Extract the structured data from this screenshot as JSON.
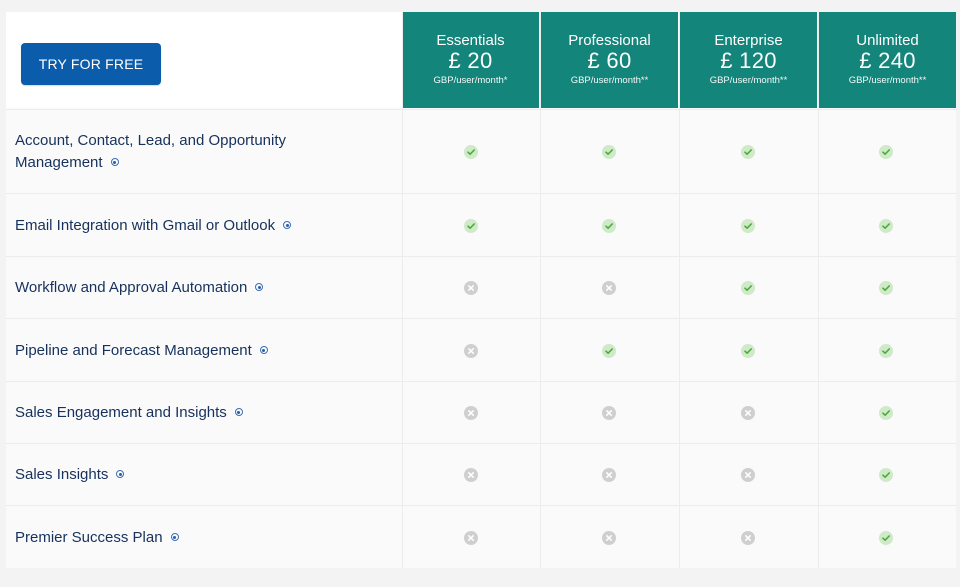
{
  "cta": {
    "label": "TRY FOR FREE"
  },
  "plans": [
    {
      "name": "Essentials",
      "price": "£ 20",
      "unit": "GBP/user/month*"
    },
    {
      "name": "Professional",
      "price": "£ 60",
      "unit": "GBP/user/month**"
    },
    {
      "name": "Enterprise",
      "price": "£ 120",
      "unit": "GBP/user/month**"
    },
    {
      "name": "Unlimited",
      "price": "£ 240",
      "unit": "GBP/user/month**"
    }
  ],
  "features": [
    {
      "line1": "Account, Contact, Lead, and Opportunity",
      "line2": "Management",
      "included": [
        true,
        true,
        true,
        true
      ]
    },
    {
      "line1": "Email Integration with Gmail or Outlook",
      "line2": "",
      "included": [
        true,
        true,
        true,
        true
      ]
    },
    {
      "line1": "Workflow and Approval Automation",
      "line2": "",
      "included": [
        false,
        false,
        true,
        true
      ]
    },
    {
      "line1": "Pipeline and Forecast Management",
      "line2": "",
      "included": [
        false,
        true,
        true,
        true
      ]
    },
    {
      "line1": "Sales Engagement and Insights",
      "line2": "",
      "included": [
        false,
        false,
        false,
        true
      ]
    },
    {
      "line1": "Sales Insights",
      "line2": "",
      "included": [
        false,
        false,
        false,
        true
      ]
    },
    {
      "line1": "Premier Success Plan",
      "line2": "",
      "included": [
        false,
        false,
        false,
        true
      ]
    }
  ],
  "icons": {
    "included": "check-circle-icon",
    "excluded": "x-circle-icon",
    "info": "info-icon"
  },
  "colors": {
    "header": "#13857a",
    "cta": "#0b5cab",
    "check": "#4bab3c",
    "cross": "#8c8c8c"
  }
}
